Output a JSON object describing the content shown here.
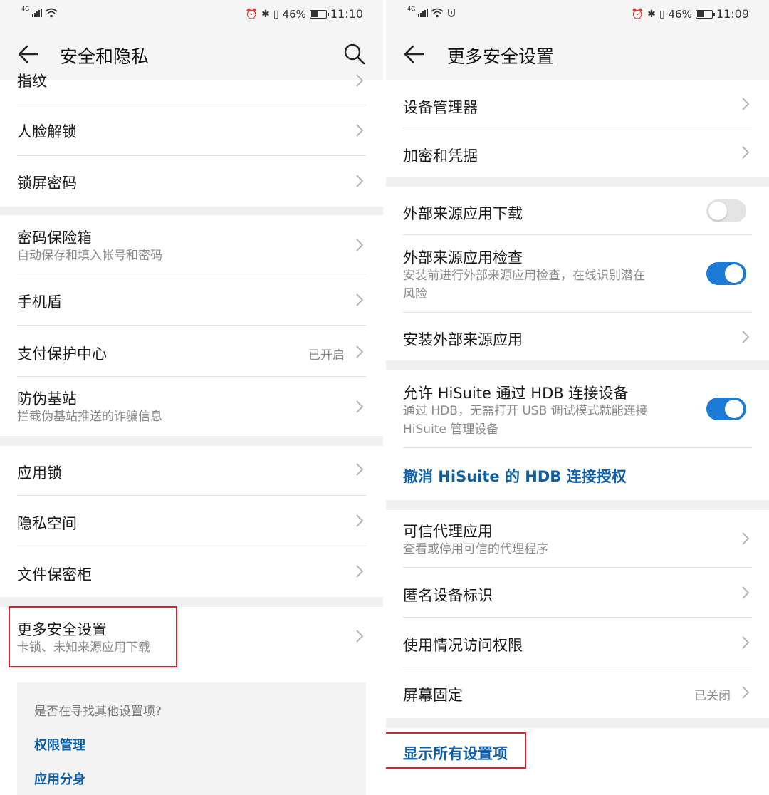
{
  "left": {
    "status": {
      "network": "4G",
      "battery": "46%",
      "time": "11:10",
      "battery_level": 0.46
    },
    "title": "安全和隐私",
    "items": {
      "fingerprint": {
        "title": "指纹"
      },
      "face_unlock": {
        "title": "人脸解锁"
      },
      "lock_password": {
        "title": "锁屏密码"
      },
      "password_vault": {
        "title": "密码保险箱",
        "subtitle": "自动保存和填入帐号和密码"
      },
      "phone_shield": {
        "title": "手机盾"
      },
      "payment_protection": {
        "title": "支付保护中心",
        "value": "已开启"
      },
      "anti_fake_station": {
        "title": "防伪基站",
        "subtitle": "拦截伪基站推送的诈骗信息"
      },
      "app_lock": {
        "title": "应用锁"
      },
      "private_space": {
        "title": "隐私空间"
      },
      "file_safe": {
        "title": "文件保密柜"
      },
      "more_security": {
        "title": "更多安全设置",
        "subtitle": "卡锁、未知来源应用下载"
      }
    },
    "suggestion": {
      "question": "是否在寻找其他设置项?",
      "links": [
        "权限管理",
        "应用分身"
      ]
    }
  },
  "right": {
    "status": {
      "network": "4G",
      "battery": "46%",
      "time": "11:09",
      "battery_level": 0.46
    },
    "title": "更多安全设置",
    "items": {
      "device_manager": {
        "title": "设备管理器"
      },
      "encryption": {
        "title": "加密和凭据"
      },
      "external_download": {
        "title": "外部来源应用下载",
        "toggle": false
      },
      "external_check": {
        "title": "外部来源应用检查",
        "subtitle": "安装前进行外部来源应用检查，在线识别潜在\n风险",
        "toggle": true
      },
      "install_external": {
        "title": "安装外部来源应用"
      },
      "hisuite_hdb": {
        "title": "允许 HiSuite 通过 HDB 连接设备",
        "subtitle": "通过 HDB，无需打开 USB 调试模式就能连接\nHiSuite 管理设备",
        "toggle": true
      },
      "revoke_hdb": {
        "title": "撤消 HiSuite 的 HDB 连接授权"
      },
      "trust_agents": {
        "title": "可信代理应用",
        "subtitle": "查看或停用可信的代理程序"
      },
      "anonymous_id": {
        "title": "匿名设备标识"
      },
      "usage_access": {
        "title": "使用情况访问权限"
      },
      "screen_pinning": {
        "title": "屏幕固定",
        "value": "已关闭"
      }
    },
    "show_all": "显示所有设置项"
  },
  "colors": {
    "accent": "#1d7bd8",
    "link": "#0f5fa8",
    "highlight": "#d6232a"
  }
}
